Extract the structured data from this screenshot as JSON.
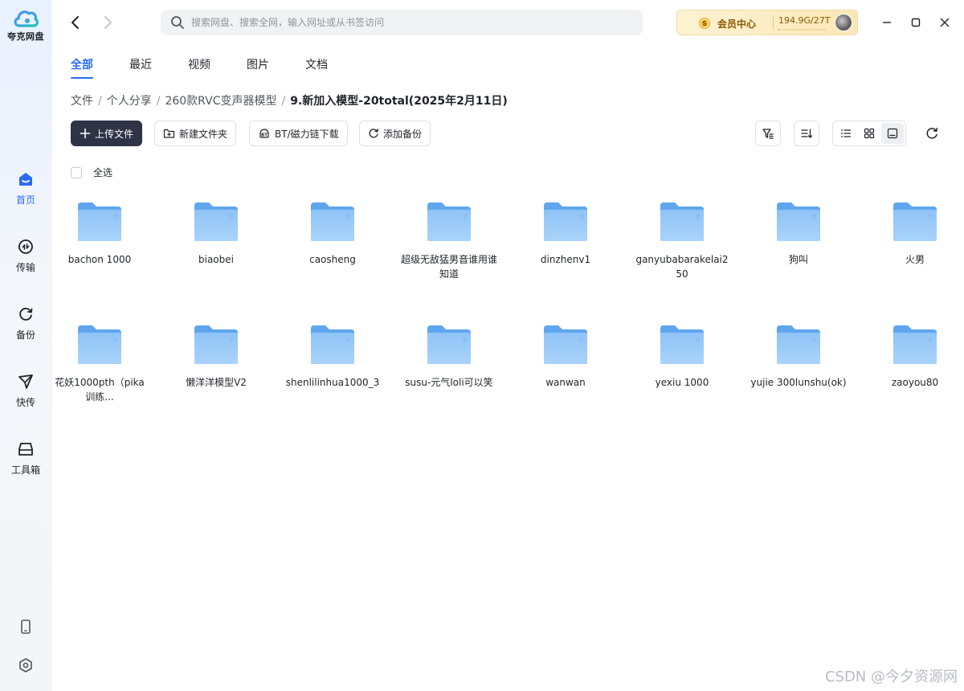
{
  "app": {
    "name": "夸克网盘",
    "brand_color": "#2a6cf5"
  },
  "sidebar": {
    "items": [
      {
        "label": "首页",
        "icon": "home-icon",
        "active": true
      },
      {
        "label": "传输",
        "icon": "transfer-icon",
        "active": false
      },
      {
        "label": "备份",
        "icon": "backup-icon",
        "active": false
      },
      {
        "label": "快传",
        "icon": "quick-send-icon",
        "active": false
      },
      {
        "label": "工具箱",
        "icon": "toolbox-icon",
        "active": false
      }
    ],
    "bottom": [
      {
        "icon": "phone-icon"
      },
      {
        "icon": "settings-icon"
      }
    ]
  },
  "search": {
    "placeholder": "搜索网盘、搜索全网，输入网址或从书签访问"
  },
  "vip": {
    "label": "会员中心",
    "storage": "194.9G/27T",
    "usage_fraction": 0.007
  },
  "tabs": [
    {
      "label": "全部",
      "active": true
    },
    {
      "label": "最近",
      "active": false
    },
    {
      "label": "视频",
      "active": false
    },
    {
      "label": "图片",
      "active": false
    },
    {
      "label": "文档",
      "active": false
    }
  ],
  "breadcrumb": [
    {
      "label": "文件"
    },
    {
      "label": "个人分享"
    },
    {
      "label": "260款RVC变声器模型"
    },
    {
      "label": "9.新加入模型-20total(2025年2月11日)"
    }
  ],
  "toolbar": {
    "upload": "上传文件",
    "new_folder": "新建文件夹",
    "bt_download": "BT/磁力链下载",
    "add_backup": "添加备份"
  },
  "select_all_label": "全选",
  "folders": [
    {
      "name": "bachon 1000"
    },
    {
      "name": "biaobei"
    },
    {
      "name": "caosheng"
    },
    {
      "name": "超级无敌猛男音谁用谁知道"
    },
    {
      "name": "dinzhenv1"
    },
    {
      "name": "ganyubabarakelai250"
    },
    {
      "name": "狗叫"
    },
    {
      "name": "火男"
    },
    {
      "name": "花妖1000pth（pika训练..."
    },
    {
      "name": "懒洋洋模型V2"
    },
    {
      "name": "shenlilinhua1000_3"
    },
    {
      "name": "susu-元气loli可以笑"
    },
    {
      "name": "wanwan"
    },
    {
      "name": "yexiu 1000"
    },
    {
      "name": "yujie 300lunshu(ok)"
    },
    {
      "name": "zaoyou80"
    }
  ],
  "watermark": "CSDN @今夕资源网"
}
